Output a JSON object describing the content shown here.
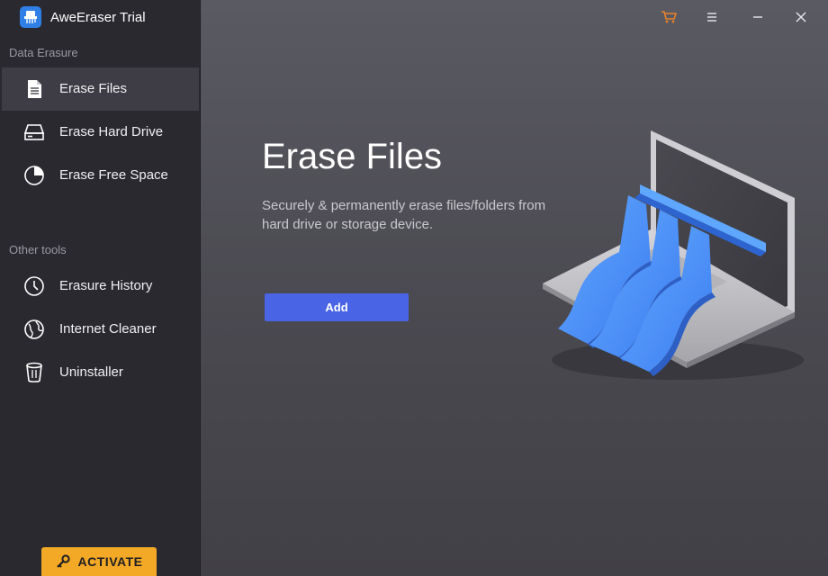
{
  "app": {
    "title": "AweEraser Trial",
    "logo_icon": "app-logo-icon"
  },
  "sidebar": {
    "sections": [
      {
        "label": "Data Erasure",
        "items": [
          {
            "label": "Erase Files",
            "icon": "file-icon",
            "active": true
          },
          {
            "label": "Erase Hard Drive",
            "icon": "hard-drive-icon",
            "active": false
          },
          {
            "label": "Erase Free Space",
            "icon": "pie-chart-icon",
            "active": false
          }
        ]
      },
      {
        "label": "Other tools",
        "items": [
          {
            "label": "Erasure History",
            "icon": "clock-icon",
            "active": false
          },
          {
            "label": "Internet Cleaner",
            "icon": "globe-icon",
            "active": false
          },
          {
            "label": "Uninstaller",
            "icon": "trash-icon",
            "active": false
          }
        ]
      }
    ],
    "activate_label": "ACTIVATE"
  },
  "titlebar": {
    "cart_icon": "cart-icon",
    "menu_icon": "menu-icon",
    "minimize_icon": "minimize-icon",
    "close_icon": "close-icon"
  },
  "main": {
    "title": "Erase Files",
    "description": "Securely & permanently erase files/folders from hard drive or storage device.",
    "add_label": "Add"
  },
  "colors": {
    "accent": "#4965e5",
    "activate": "#f3a826",
    "cart": "#e8822a",
    "sidebar_bg": "#2a2930",
    "sidebar_active": "#3e3d45"
  }
}
